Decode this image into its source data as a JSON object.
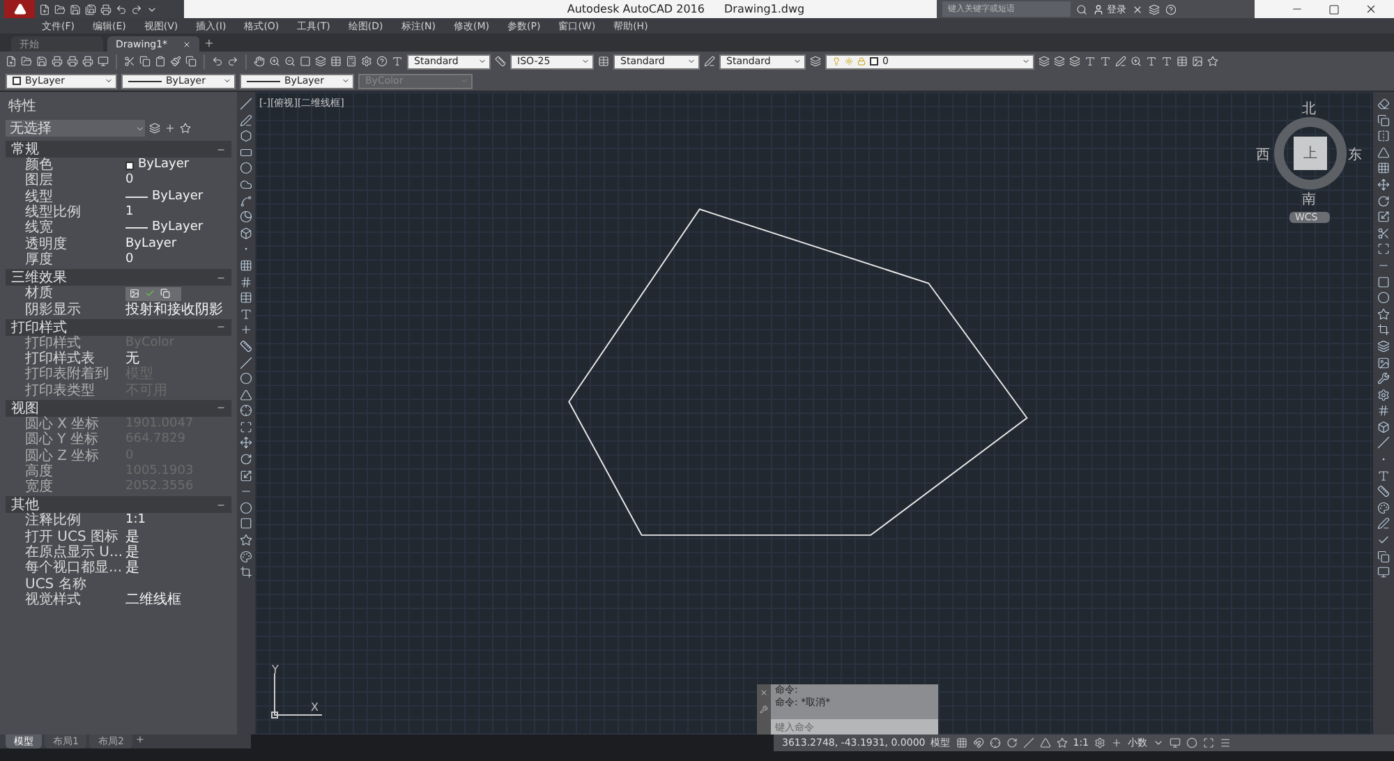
{
  "title_bar": {
    "app_title": "Autodesk AutoCAD 2016",
    "file_name": "Drawing1.dwg",
    "search": {
      "placeholder": "键入关键字或短语"
    },
    "login": "登录"
  },
  "menu_bar": [
    "文件(F)",
    "编辑(E)",
    "视图(V)",
    "插入(I)",
    "格式(O)",
    "工具(T)",
    "绘图(D)",
    "标注(N)",
    "修改(M)",
    "参数(P)",
    "窗口(W)",
    "帮助(H)"
  ],
  "file_tabs": [
    {
      "label": "开始",
      "selected": false
    },
    {
      "label": "Drawing1*",
      "selected": true
    }
  ],
  "toolbar": {
    "text_style": "Standard",
    "dim_style": "ISO-25",
    "table_style": "Standard",
    "multileader_style": "Standard",
    "layer": "0"
  },
  "properties_toolbar": [
    {
      "kind": "color",
      "value": "ByLayer",
      "disabled": false
    },
    {
      "kind": "linetype",
      "value": "ByLayer",
      "disabled": false
    },
    {
      "kind": "linetype",
      "value": "ByLayer",
      "disabled": false
    },
    {
      "kind": "text",
      "value": "ByColor",
      "disabled": true
    }
  ],
  "properties_panel": {
    "title": "特性",
    "selection": "无选择",
    "sections": [
      {
        "title": "常规",
        "expanded": true,
        "rows": [
          {
            "kind": "color",
            "label": "颜色",
            "value": "ByLayer",
            "greyed": false
          },
          {
            "kind": "text",
            "label": "图层",
            "value": "0",
            "greyed": false
          },
          {
            "kind": "linetype",
            "label": "线型",
            "value": "ByLayer",
            "greyed": false
          },
          {
            "kind": "text",
            "label": "线型比例",
            "value": "1",
            "greyed": false
          },
          {
            "kind": "linetype",
            "label": "线宽",
            "value": "ByLayer",
            "greyed": false
          },
          {
            "kind": "text",
            "label": "透明度",
            "value": "ByLayer",
            "greyed": false
          },
          {
            "kind": "text",
            "label": "厚度",
            "value": "0",
            "greyed": false
          }
        ]
      },
      {
        "title": "三维效果",
        "expanded": true,
        "rows": [
          {
            "kind": "material",
            "label": "材质",
            "greyed": false
          },
          {
            "kind": "text",
            "label": "阴影显示",
            "value": "投射和接收阴影",
            "greyed": false
          }
        ]
      },
      {
        "title": "打印样式",
        "expanded": true,
        "rows": [
          {
            "kind": "text",
            "label": "打印样式",
            "value": "ByColor",
            "greyed": true
          },
          {
            "kind": "text",
            "label": "打印样式表",
            "value": "无",
            "greyed": false
          },
          {
            "kind": "text",
            "label": "打印表附着到",
            "value": "模型",
            "greyed": true
          },
          {
            "kind": "text",
            "label": "打印表类型",
            "value": "不可用",
            "greyed": true
          }
        ]
      },
      {
        "title": "视图",
        "expanded": true,
        "rows": [
          {
            "kind": "text",
            "label": "圆心 X 坐标",
            "value": "1901.0047",
            "greyed": true
          },
          {
            "kind": "text",
            "label": "圆心 Y 坐标",
            "value": "664.7829",
            "greyed": true
          },
          {
            "kind": "text",
            "label": "圆心 Z 坐标",
            "value": "0",
            "greyed": true
          },
          {
            "kind": "text",
            "label": "高度",
            "value": "1005.1903",
            "greyed": true
          },
          {
            "kind": "text",
            "label": "宽度",
            "value": "2052.3556",
            "greyed": true
          }
        ]
      },
      {
        "title": "其他",
        "expanded": true,
        "rows": [
          {
            "kind": "text",
            "label": "注释比例",
            "value": "1:1",
            "greyed": false
          },
          {
            "kind": "text",
            "label": "打开 UCS 图标",
            "value": "是",
            "greyed": false
          },
          {
            "kind": "text",
            "label": "在原点显示 U...",
            "value": "是",
            "greyed": false
          },
          {
            "kind": "text",
            "label": "每个视口都显...",
            "value": "是",
            "greyed": false
          },
          {
            "kind": "text",
            "label": "UCS 名称",
            "greyed": false
          },
          {
            "kind": "text",
            "label": "视觉样式",
            "value": "二维线框",
            "greyed": false
          }
        ]
      }
    ]
  },
  "viewport": {
    "label": "[-][俯视][二维线框]",
    "viewcube": {
      "north": "北",
      "south": "南",
      "east": "东",
      "west": "西",
      "face": "上",
      "ucs": "WCS"
    },
    "ucs_axes": {
      "x": "X",
      "y": "Y"
    }
  },
  "command_line": {
    "history": [
      "命令:",
      "命令: *取消*"
    ],
    "placeholder": "键入命令"
  },
  "layout_tabs": [
    {
      "label": "模型",
      "selected": true
    },
    {
      "label": "布局1",
      "selected": false
    },
    {
      "label": "布局2",
      "selected": false
    }
  ],
  "status_bar": {
    "coordinates": "3613.2748, -43.1931, 0.0000",
    "space": "模型",
    "annotation_scale": "1:1",
    "units": "小数"
  }
}
